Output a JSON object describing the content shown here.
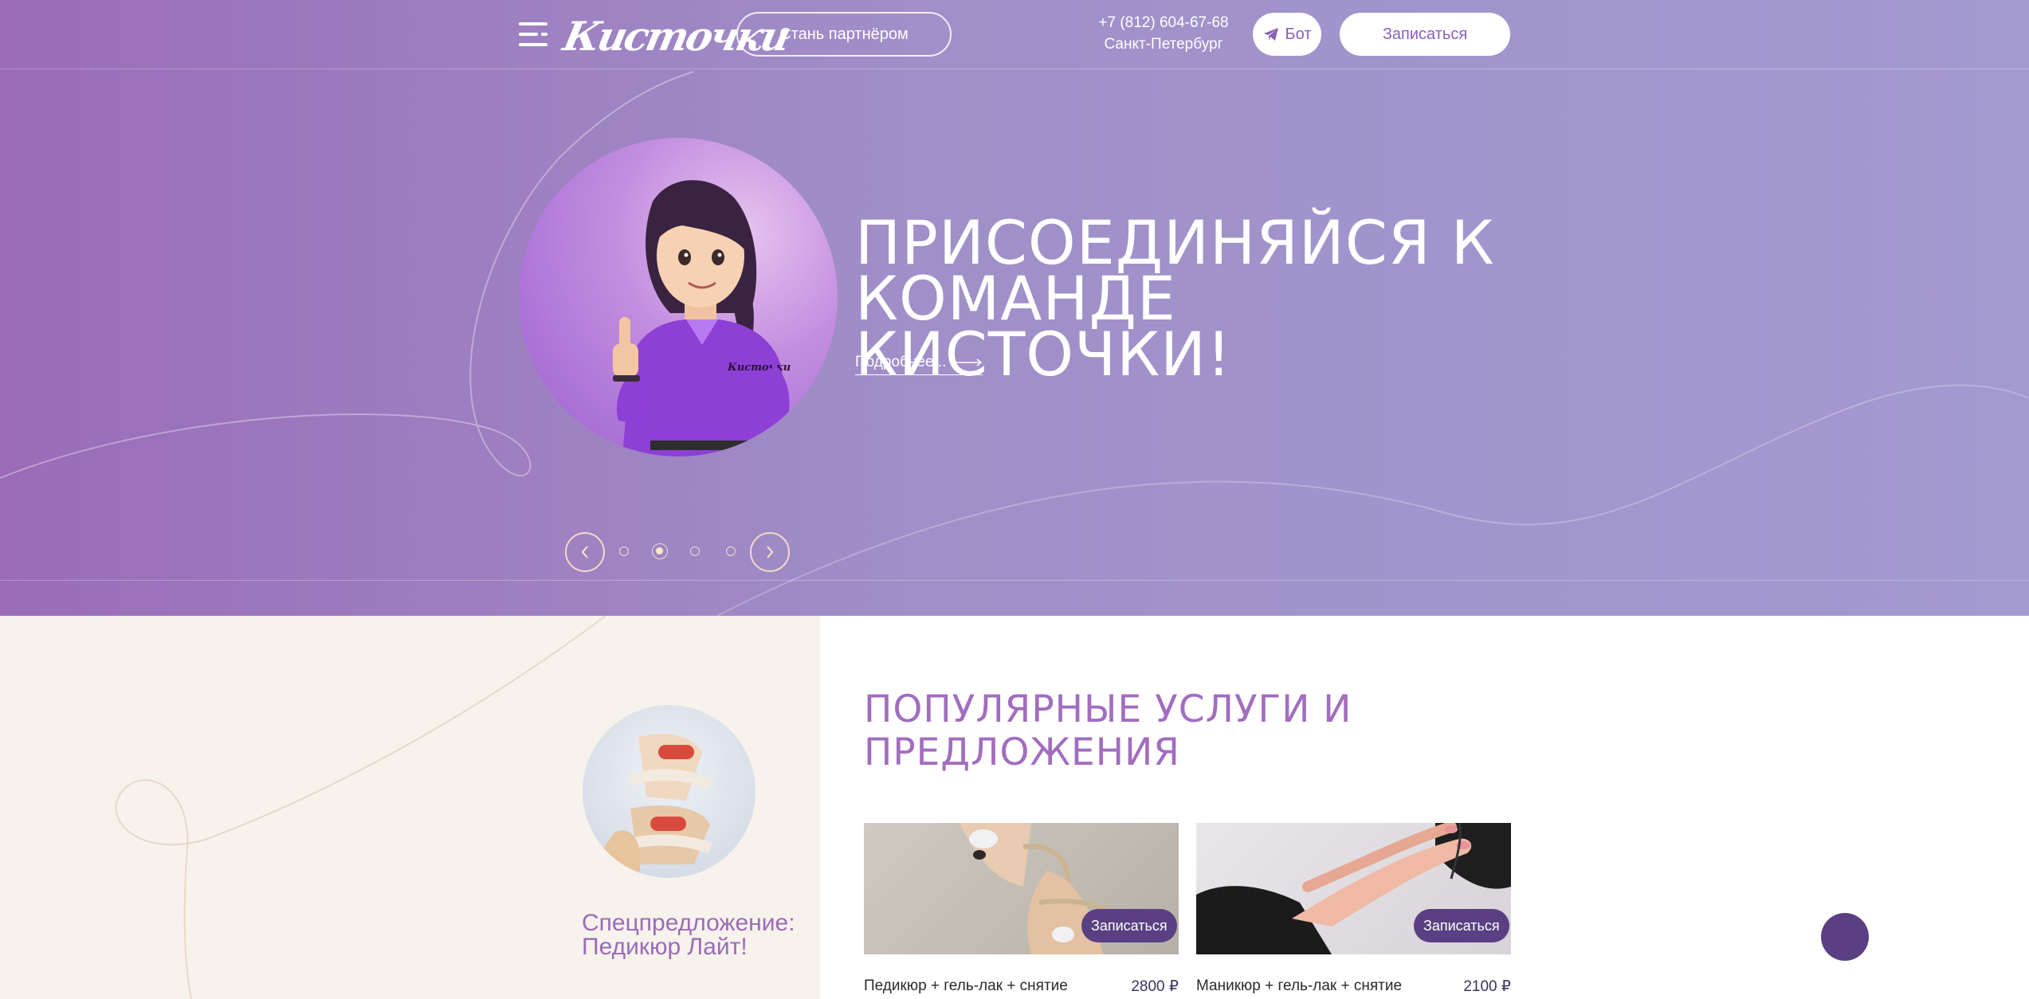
{
  "header": {
    "logo_text": "Кисточки",
    "partner_label": "Стань партнёром",
    "phone": "+7 (812) 604-67-68",
    "city": "Санкт-Петербург",
    "bot_label": "Бот",
    "book_label": "Записаться"
  },
  "hero": {
    "title": "ПРИСОЕДИНЯЙСЯ К КОМАНДЕ КИСТОЧКИ!",
    "more_label": "Подробнее...",
    "mascot_logo": "Кисточки",
    "slides_count": 4,
    "active_slide": 2
  },
  "special": {
    "title": "Спецпредложение: Педикюр Лайт!"
  },
  "popular": {
    "title": "ПОПУЛЯРНЫЕ УСЛУГИ И ПРЕДЛОЖЕНИЯ",
    "cards": [
      {
        "name": "Педикюр + гель-лак + снятие",
        "price": "2800 ₽",
        "button": "Записаться"
      },
      {
        "name": "Маникюр + гель-лак + снятие",
        "price": "2100 ₽",
        "button": "Записаться"
      }
    ]
  },
  "colors": {
    "hero_start": "#9a6cb8",
    "hero_end": "#a39ad0",
    "accent": "#a26dbf",
    "button_dark": "#5a3f82",
    "panel_cream": "#f7f2ec"
  }
}
